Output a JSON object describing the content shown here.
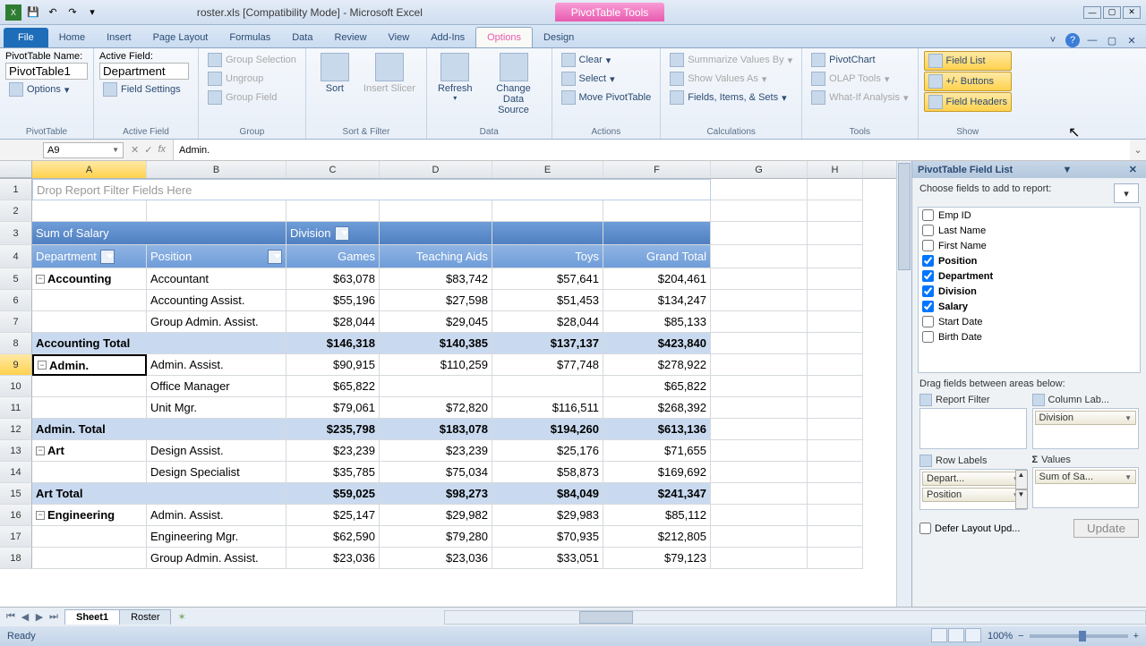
{
  "title": "roster.xls  [Compatibility Mode] - Microsoft Excel",
  "contextual_tab": "PivotTable Tools",
  "tabs": [
    "File",
    "Home",
    "Insert",
    "Page Layout",
    "Formulas",
    "Data",
    "Review",
    "View",
    "Add-Ins",
    "Options",
    "Design"
  ],
  "active_tab": "Options",
  "ribbon": {
    "pivottable": {
      "name_label": "PivotTable Name:",
      "name_value": "PivotTable1",
      "options": "Options",
      "group_label": "PivotTable"
    },
    "activefield": {
      "label": "Active Field:",
      "value": "Department",
      "settings": "Field Settings",
      "group_label": "Active Field"
    },
    "group": {
      "sel": "Group Selection",
      "ungroup": "Ungroup",
      "field": "Group Field",
      "group_label": "Group"
    },
    "sortfilter": {
      "sort": "Sort",
      "slicer": "Insert Slicer",
      "group_label": "Sort & Filter"
    },
    "data": {
      "refresh": "Refresh",
      "change": "Change Data Source",
      "group_label": "Data"
    },
    "actions": {
      "clear": "Clear",
      "select": "Select",
      "move": "Move PivotTable",
      "group_label": "Actions"
    },
    "calc": {
      "summarize": "Summarize Values By",
      "showas": "Show Values As",
      "fields": "Fields, Items, & Sets",
      "group_label": "Calculations"
    },
    "tools": {
      "chart": "PivotChart",
      "olap": "OLAP Tools",
      "whatif": "What-If Analysis",
      "group_label": "Tools"
    },
    "show": {
      "fieldlist": "Field List",
      "buttons": "+/- Buttons",
      "headers": "Field Headers",
      "group_label": "Show"
    }
  },
  "namebox": "A9",
  "formula": "Admin.",
  "columns": [
    "A",
    "B",
    "C",
    "D",
    "E",
    "F",
    "G",
    "H"
  ],
  "drop_filter_text": "Drop Report Filter Fields Here",
  "pivot": {
    "measure": "Sum of Salary",
    "col_field": "Division",
    "row_fields": [
      "Department",
      "Position"
    ],
    "col_labels": [
      "Games",
      "Teaching Aids",
      "Toys",
      "Grand Total"
    ]
  },
  "chart_data": {
    "type": "table",
    "rows": [
      {
        "dept": "Accounting",
        "pos": "Accountant",
        "v": [
          "$63,078",
          "$83,742",
          "$57,641",
          "$204,461"
        ],
        "kind": "data",
        "first": true
      },
      {
        "dept": "",
        "pos": "Accounting Assist.",
        "v": [
          "$55,196",
          "$27,598",
          "$51,453",
          "$134,247"
        ],
        "kind": "data"
      },
      {
        "dept": "",
        "pos": "Group Admin. Assist.",
        "v": [
          "$28,044",
          "$29,045",
          "$28,044",
          "$85,133"
        ],
        "kind": "data"
      },
      {
        "dept": "Accounting Total",
        "pos": "",
        "v": [
          "$146,318",
          "$140,385",
          "$137,137",
          "$423,840"
        ],
        "kind": "sub"
      },
      {
        "dept": "Admin.",
        "pos": "Admin. Assist.",
        "v": [
          "$90,915",
          "$110,259",
          "$77,748",
          "$278,922"
        ],
        "kind": "data",
        "first": true,
        "sel": true
      },
      {
        "dept": "",
        "pos": "Office Manager",
        "v": [
          "$65,822",
          "",
          "",
          "$65,822"
        ],
        "kind": "data"
      },
      {
        "dept": "",
        "pos": "Unit Mgr.",
        "v": [
          "$79,061",
          "$72,820",
          "$116,511",
          "$268,392"
        ],
        "kind": "data"
      },
      {
        "dept": "Admin. Total",
        "pos": "",
        "v": [
          "$235,798",
          "$183,078",
          "$194,260",
          "$613,136"
        ],
        "kind": "sub"
      },
      {
        "dept": "Art",
        "pos": "Design Assist.",
        "v": [
          "$23,239",
          "$23,239",
          "$25,176",
          "$71,655"
        ],
        "kind": "data",
        "first": true
      },
      {
        "dept": "",
        "pos": "Design Specialist",
        "v": [
          "$35,785",
          "$75,034",
          "$58,873",
          "$169,692"
        ],
        "kind": "data"
      },
      {
        "dept": "Art Total",
        "pos": "",
        "v": [
          "$59,025",
          "$98,273",
          "$84,049",
          "$241,347"
        ],
        "kind": "sub"
      },
      {
        "dept": "Engineering",
        "pos": "Admin. Assist.",
        "v": [
          "$25,147",
          "$29,982",
          "$29,983",
          "$85,112"
        ],
        "kind": "data",
        "first": true
      },
      {
        "dept": "",
        "pos": "Engineering Mgr.",
        "v": [
          "$62,590",
          "$79,280",
          "$70,935",
          "$212,805"
        ],
        "kind": "data"
      },
      {
        "dept": "",
        "pos": "Group Admin. Assist.",
        "v": [
          "$23,036",
          "$23,036",
          "$33,051",
          "$79,123"
        ],
        "kind": "data"
      }
    ]
  },
  "fieldlist": {
    "title": "PivotTable Field List",
    "choose": "Choose fields to add to report:",
    "fields": [
      {
        "name": "Emp ID",
        "checked": false
      },
      {
        "name": "Last Name",
        "checked": false
      },
      {
        "name": "First Name",
        "checked": false
      },
      {
        "name": "Position",
        "checked": true
      },
      {
        "name": "Department",
        "checked": true
      },
      {
        "name": "Division",
        "checked": true
      },
      {
        "name": "Salary",
        "checked": true
      },
      {
        "name": "Start Date",
        "checked": false
      },
      {
        "name": "Birth Date",
        "checked": false
      }
    ],
    "drag_label": "Drag fields between areas below:",
    "areas": {
      "filter": {
        "label": "Report Filter",
        "items": []
      },
      "columns": {
        "label": "Column Lab...",
        "items": [
          "Division"
        ]
      },
      "rows": {
        "label": "Row Labels",
        "items": [
          "Depart...",
          "Position"
        ]
      },
      "values": {
        "label": "Values",
        "items": [
          "Sum of Sa..."
        ]
      }
    },
    "defer": "Defer Layout Upd...",
    "update": "Update"
  },
  "sheets": [
    "Sheet1",
    "Roster"
  ],
  "status": {
    "ready": "Ready",
    "zoom": "100%"
  }
}
